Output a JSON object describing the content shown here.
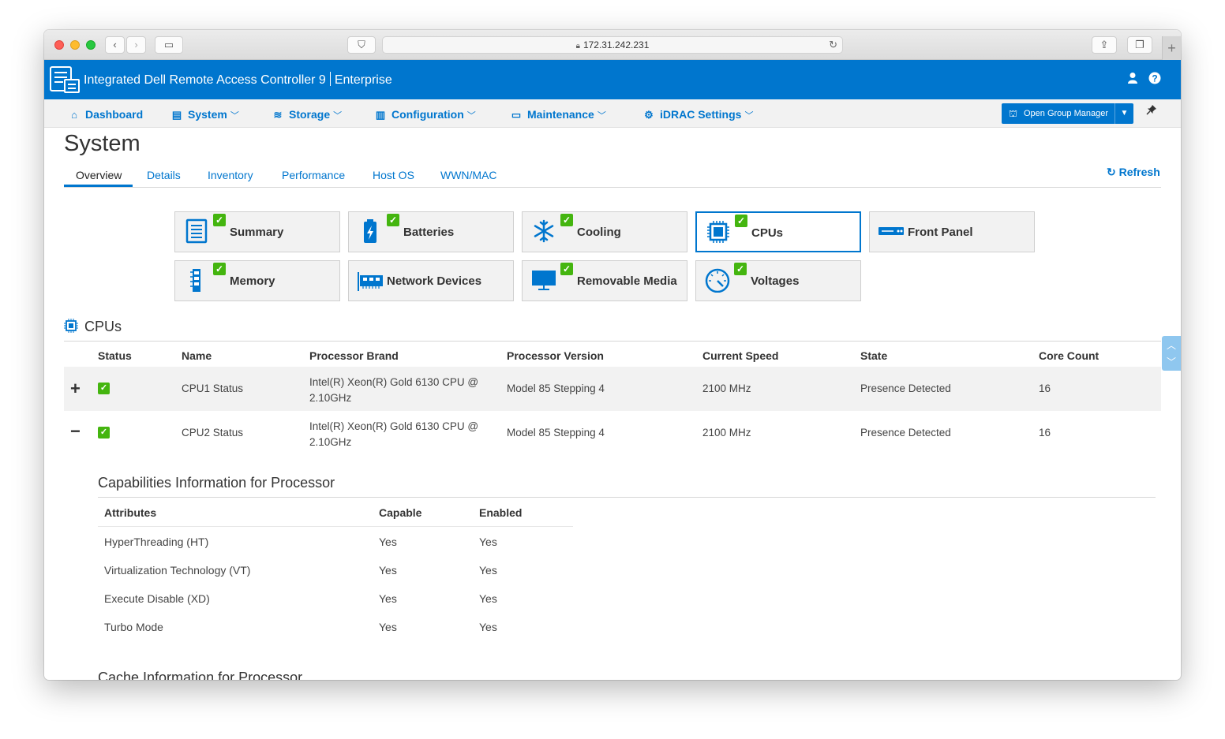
{
  "browser": {
    "url": "172.31.242.231"
  },
  "header": {
    "product": "Integrated Dell Remote Access Controller 9",
    "edition": "Enterprise"
  },
  "nav": {
    "items": [
      {
        "label": "Dashboard",
        "icon": "home-icon"
      },
      {
        "label": "System",
        "icon": "server-icon"
      },
      {
        "label": "Storage",
        "icon": "database-icon"
      },
      {
        "label": "Configuration",
        "icon": "config-icon"
      },
      {
        "label": "Maintenance",
        "icon": "maintenance-icon"
      },
      {
        "label": "iDRAC Settings",
        "icon": "gears-icon"
      }
    ],
    "group_manager": "Open Group Manager"
  },
  "page": {
    "title": "System",
    "tabs": [
      "Overview",
      "Details",
      "Inventory",
      "Performance",
      "Host OS",
      "WWN/MAC"
    ],
    "active_tab": "Overview",
    "refresh": "Refresh"
  },
  "tiles": [
    {
      "label": "Summary",
      "icon": "summary-icon",
      "status": "ok",
      "selected": false
    },
    {
      "label": "Batteries",
      "icon": "battery-icon",
      "status": "ok",
      "selected": false
    },
    {
      "label": "Cooling",
      "icon": "snowflake-icon",
      "status": "ok",
      "selected": false
    },
    {
      "label": "CPUs",
      "icon": "cpu-icon",
      "status": "ok",
      "selected": true
    },
    {
      "label": "Front Panel",
      "icon": "front-panel-icon",
      "status": "none",
      "selected": false
    },
    {
      "label": "Memory",
      "icon": "memory-icon",
      "status": "ok",
      "selected": false
    },
    {
      "label": "Network Devices",
      "icon": "network-card-icon",
      "status": "none",
      "selected": false
    },
    {
      "label": "Removable Media",
      "icon": "monitor-icon",
      "status": "ok",
      "selected": false
    },
    {
      "label": "Voltages",
      "icon": "gauge-icon",
      "status": "ok",
      "selected": false
    }
  ],
  "cpus": {
    "title": "CPUs",
    "columns": [
      "Status",
      "Name",
      "Processor Brand",
      "Processor Version",
      "Current Speed",
      "State",
      "Core Count"
    ],
    "rows": [
      {
        "expander": "+",
        "name": "CPU1 Status",
        "brand": "Intel(R) Xeon(R) Gold 6130 CPU @ 2.10GHz",
        "version": "Model 85 Stepping 4",
        "speed": "2100 MHz",
        "state": "Presence Detected",
        "cores": "16"
      },
      {
        "expander": "−",
        "name": "CPU2 Status",
        "brand": "Intel(R) Xeon(R) Gold 6130 CPU @ 2.10GHz",
        "version": "Model 85 Stepping 4",
        "speed": "2100 MHz",
        "state": "Presence Detected",
        "cores": "16"
      }
    ]
  },
  "capabilities": {
    "title": "Capabilities Information for Processor",
    "columns": [
      "Attributes",
      "Capable",
      "Enabled"
    ],
    "rows": [
      {
        "attr": "HyperThreading (HT)",
        "capable": "Yes",
        "enabled": "Yes"
      },
      {
        "attr": "Virtualization Technology (VT)",
        "capable": "Yes",
        "enabled": "Yes"
      },
      {
        "attr": "Execute Disable (XD)",
        "capable": "Yes",
        "enabled": "Yes"
      },
      {
        "attr": "Turbo Mode",
        "capable": "Yes",
        "enabled": "Yes"
      }
    ]
  },
  "cache": {
    "title": "Cache Information for Processor"
  },
  "colors": {
    "brand_blue": "#0076ce",
    "ok_green": "#44b50f"
  }
}
